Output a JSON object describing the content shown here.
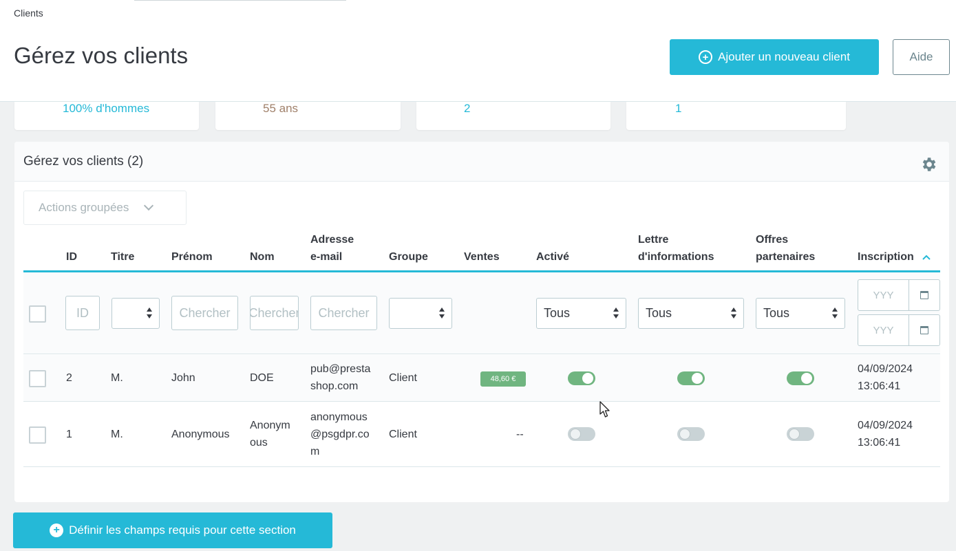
{
  "header": {
    "breadcrumb": "Clients",
    "title": "Gérez vos clients",
    "add_button": "Ajouter un nouveau client",
    "help_button": "Aide"
  },
  "kpis": [
    {
      "value": "100% d'hommes",
      "color": "#25b9d7"
    },
    {
      "value": "55 ans",
      "color": "#a0806a"
    },
    {
      "value": "2",
      "color": "#25b9d7"
    },
    {
      "value": "1",
      "color": "#25b9d7"
    }
  ],
  "panel": {
    "title": "Gérez vos clients (2)",
    "bulk_actions": "Actions groupées"
  },
  "table": {
    "headers": {
      "id": "ID",
      "title": "Titre",
      "firstname": "Prénom",
      "lastname": "Nom",
      "email_l1": "Adresse",
      "email_l2": "e-mail",
      "group": "Groupe",
      "sales": "Ventes",
      "active": "Activé",
      "newsletter_l1": "Lettre",
      "newsletter_l2": "d'informations",
      "optin_l1": "Offres",
      "optin_l2": "partenaires",
      "date_add": "Inscription"
    },
    "filters": {
      "id_placeholder": "ID",
      "firstname_placeholder": "Chercher",
      "lastname_placeholder": "Chercher",
      "email_placeholder": "Chercher",
      "active": "Tous",
      "newsletter": "Tous",
      "optin": "Tous",
      "date_from": "YYY",
      "date_to": "YYY"
    },
    "rows": [
      {
        "id": "2",
        "title": "M.",
        "firstname": "John",
        "lastname": "DOE",
        "email_l1": "pub@presta",
        "email_l2": "shop.com",
        "group": "Client",
        "sales": "48,60 €",
        "active": true,
        "newsletter": true,
        "optin": true,
        "date_l1": "04/09/2024",
        "date_l2": "13:06:41"
      },
      {
        "id": "1",
        "title": "M.",
        "firstname": "Anonymous",
        "lastname_l1": "Anonym",
        "lastname_l2": "ous",
        "email_l1": "anonymous",
        "email_l2": "@psgdpr.co",
        "email_l3": "m",
        "group": "Client",
        "sales": "--",
        "active": false,
        "newsletter": false,
        "optin": false,
        "date_l1": "04/09/2024",
        "date_l2": "13:06:41"
      }
    ]
  },
  "footer": {
    "required_fields_button": "Définir les champs requis pour cette section"
  },
  "colors": {
    "primary": "#25b9d7",
    "success": "#70b580"
  }
}
